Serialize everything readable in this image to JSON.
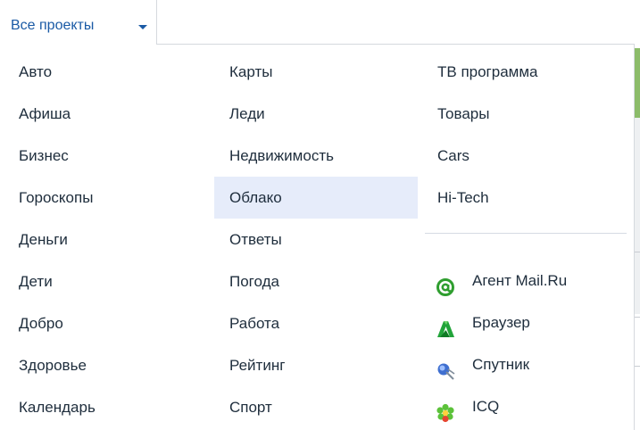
{
  "trigger": {
    "label": "Все проекты"
  },
  "columns": {
    "col1": [
      "Авто",
      "Афиша",
      "Бизнес",
      "Гороскопы",
      "Деньги",
      "Дети",
      "Добро",
      "Здоровье",
      "Календарь"
    ],
    "col2": [
      "Карты",
      "Леди",
      "Недвижимость",
      "Облако",
      "Ответы",
      "Погода",
      "Работа",
      "Рейтинг",
      "Спорт"
    ],
    "col3": [
      "ТВ программа",
      "Товары",
      "Cars",
      "Hi-Tech"
    ]
  },
  "active_item": "Облако",
  "apps": [
    {
      "label": "Агент Mail.Ru",
      "icon": "mail-agent-icon"
    },
    {
      "label": "Браузер",
      "icon": "browser-icon"
    },
    {
      "label": "Спутник",
      "icon": "sputnik-icon"
    },
    {
      "label": "ICQ",
      "icon": "icq-icon"
    }
  ],
  "colors": {
    "link": "#1a5aa5",
    "text": "#1e2d3c",
    "active_bg": "#e6ecfa"
  }
}
